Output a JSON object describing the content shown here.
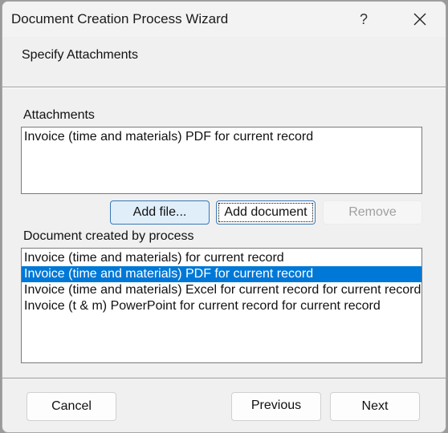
{
  "window": {
    "title": "Document Creation Process Wizard",
    "help_label": "?",
    "close_icon": "close-icon"
  },
  "header": {
    "step_title": "Specify Attachments"
  },
  "attachments": {
    "label": "Attachments",
    "items": [
      "Invoice (time and materials) PDF for current record"
    ],
    "buttons": {
      "add_file": "Add file...",
      "add_document": "Add document",
      "remove": "Remove"
    }
  },
  "documents": {
    "label": "Document created by process",
    "items": [
      "Invoice (time and materials) for current record",
      "Invoice (time and materials) PDF for current record",
      "Invoice (time and materials) Excel for current record for current record",
      "Invoice (t & m) PowerPoint for current record for current record"
    ],
    "selected_index": 1
  },
  "footer": {
    "cancel": "Cancel",
    "previous": "Previous",
    "next": "Next"
  },
  "colors": {
    "selection": "#0078d7",
    "hover_button": "#e0eef9",
    "focus_border": "#3a78b5"
  }
}
